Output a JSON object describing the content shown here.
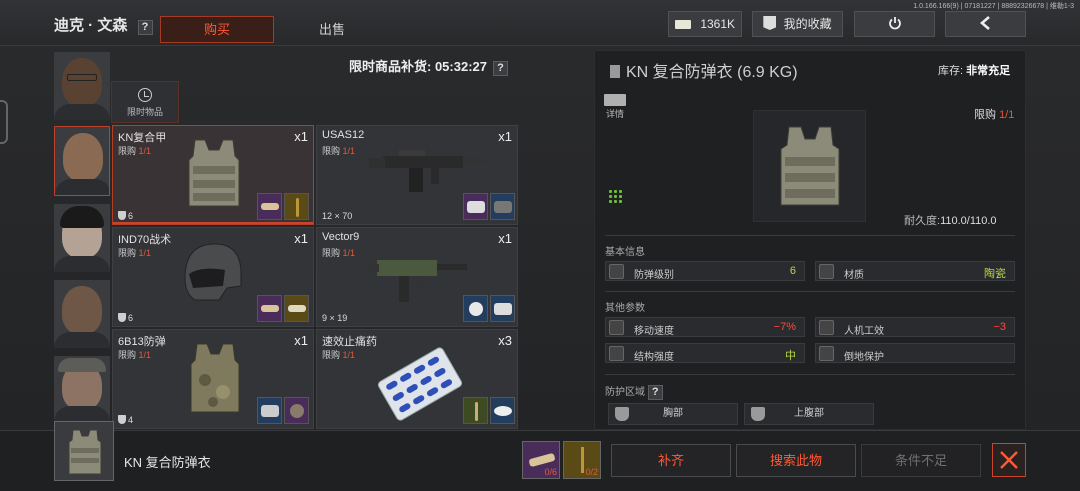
{
  "header": {
    "player_name": "迪克 · 文森",
    "help": "?",
    "tab_buy": "购买",
    "tab_sell": "出售",
    "currency": "1361K",
    "favorites": "我的收藏",
    "version": "1.0.166.166(9) | 07181227 | 88892326678 | 维勒1-3"
  },
  "left": {
    "limited_items": "限时物品",
    "restock": "限时商品补货: 05:32:27",
    "restock_help": "?"
  },
  "cards": [
    {
      "name": "KN复合甲",
      "limit_label": "限购",
      "limit": "1/1",
      "qty": "x1",
      "footer": "6"
    },
    {
      "name": "USAS12",
      "limit_label": "限购",
      "limit": "1/1",
      "qty": "x1",
      "footer": "12 × 70"
    },
    {
      "name": "IND70战术",
      "limit_label": "限购",
      "limit": "1/1",
      "qty": "x1",
      "footer": "6"
    },
    {
      "name": "Vector9",
      "limit_label": "限购",
      "limit": "1/1",
      "qty": "x1",
      "footer": "9 × 19"
    },
    {
      "name": "6B13防弹",
      "limit_label": "限购",
      "limit": "1/1",
      "qty": "x1",
      "footer": "4"
    },
    {
      "name": "速效止痛药",
      "limit_label": "限购",
      "limit": "1/1",
      "qty": "x3",
      "footer": ""
    }
  ],
  "detail": {
    "title": "KN 复合防弹衣 (6.9 KG)",
    "stock_label": "库存:",
    "stock_value": "非常充足",
    "detail_btn": "详情",
    "limit_label": "限购",
    "limit_value": "1/1",
    "durability_label": "耐久度:",
    "durability_value": "110.0/110.0",
    "basic_info": "基本信息",
    "armor_level_label": "防弹级别",
    "armor_level_value": "6",
    "material_label": "材质",
    "material_value": "陶瓷",
    "other_params": "其他参数",
    "move_speed_label": "移动速度",
    "move_speed_value": "−7%",
    "ergonomics_label": "人机工效",
    "ergonomics_value": "−3",
    "structure_label": "结构强度",
    "structure_value": "中",
    "fall_label": "倒地保护",
    "protect_zone": "防护区域",
    "protect_help": "?",
    "zone_chest": "胸部",
    "zone_abdomen": "上腹部"
  },
  "bottom": {
    "item_name": "KN 复合防弹衣",
    "mat1_count": "0/6",
    "mat2_count": "0/2",
    "btn_fill": "补齐",
    "btn_search": "搜索此物",
    "btn_insufficient": "条件不足"
  },
  "colors": {
    "accent": "#ff5a36",
    "positive": "#b7d84a",
    "negative": "#ff4a3a"
  }
}
